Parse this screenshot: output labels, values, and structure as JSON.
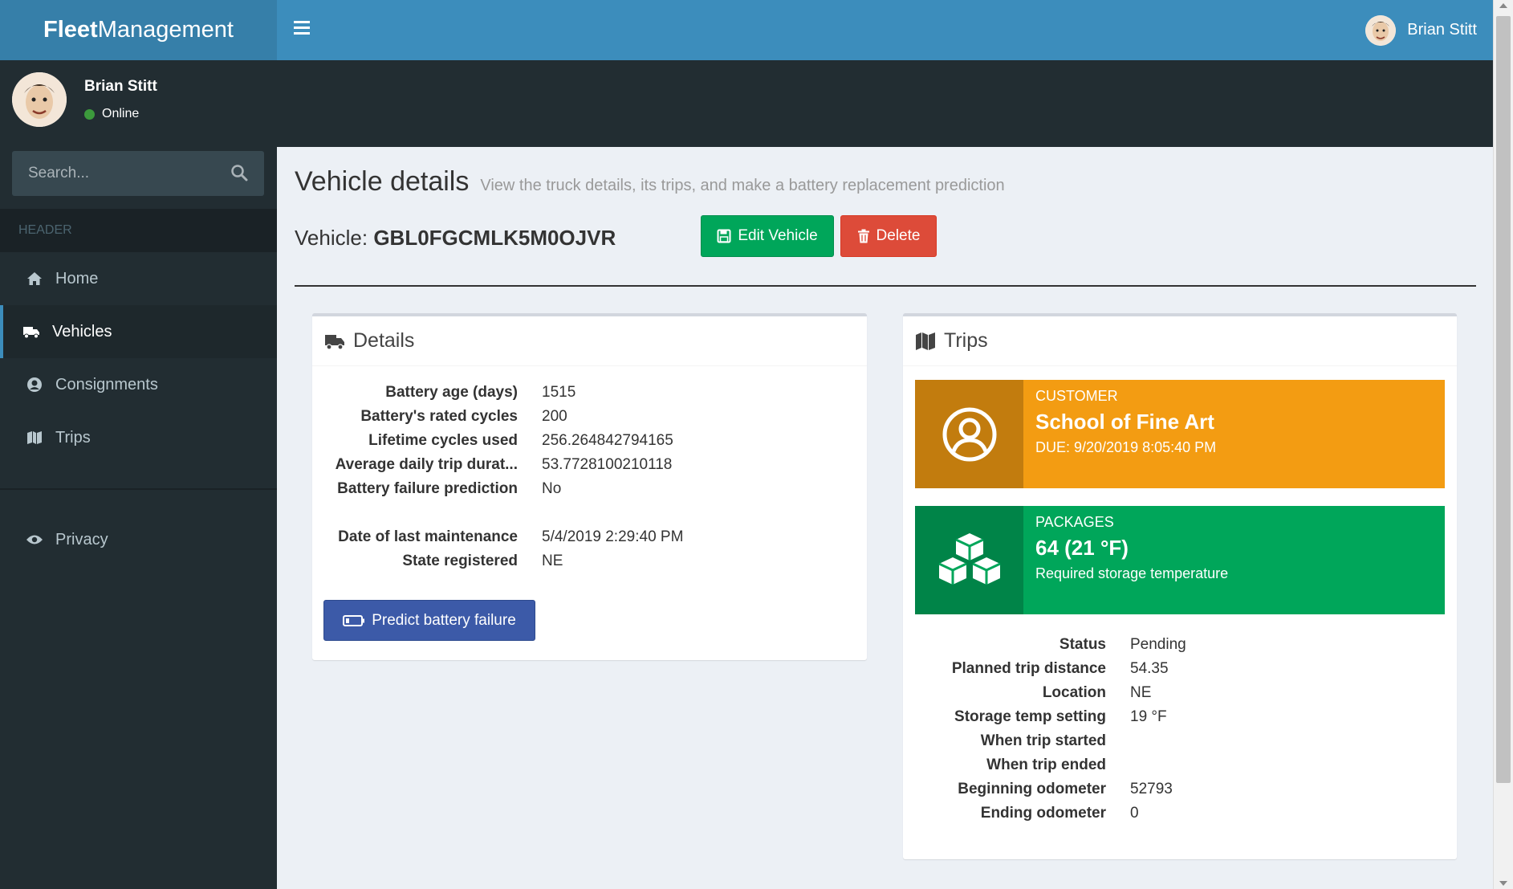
{
  "app": {
    "brand_bold": "Fleet",
    "brand_rest": "Management"
  },
  "top_user": {
    "name": "Brian Stitt"
  },
  "sidebar": {
    "user": {
      "name": "Brian Stitt",
      "status": "Online"
    },
    "search": {
      "placeholder": "Search..."
    },
    "header": "HEADER",
    "items": [
      {
        "label": "Home",
        "icon": "home-icon"
      },
      {
        "label": "Vehicles",
        "icon": "truck-icon",
        "active": true
      },
      {
        "label": "Consignments",
        "icon": "user-circle-icon"
      },
      {
        "label": "Trips",
        "icon": "map-icon"
      }
    ],
    "items2": [
      {
        "label": "Privacy",
        "icon": "eye-icon"
      }
    ]
  },
  "page": {
    "title": "Vehicle details",
    "subtitle": "View the truck details, its trips, and make a battery replacement prediction",
    "vehicle_label": "Vehicle:",
    "vehicle_id": "GBL0FGCMLK5M0OJVR",
    "edit_label": "Edit Vehicle",
    "delete_label": "Delete"
  },
  "details": {
    "title": "Details",
    "rows": [
      {
        "label": "Battery age (days)",
        "value": "1515"
      },
      {
        "label": "Battery's rated cycles",
        "value": "200"
      },
      {
        "label": "Lifetime cycles used",
        "value": "256.264842794165"
      },
      {
        "label": "Average daily trip durat...",
        "value": "53.7728100210118"
      },
      {
        "label": "Battery failure prediction",
        "value": "No"
      }
    ],
    "rows2": [
      {
        "label": "Date of last maintenance",
        "value": "5/4/2019 2:29:40 PM"
      },
      {
        "label": "State registered",
        "value": "NE"
      }
    ],
    "predict_label": "Predict battery failure"
  },
  "trips": {
    "title": "Trips",
    "customer": {
      "label": "CUSTOMER",
      "value": "School of Fine Art",
      "sub": "DUE: 9/20/2019 8:05:40 PM"
    },
    "packages": {
      "label": "PACKAGES",
      "value": "64 (21 °F)",
      "sub": "Required storage temperature"
    },
    "rows": [
      {
        "label": "Status",
        "value": "Pending"
      },
      {
        "label": "Planned trip distance",
        "value": "54.35"
      },
      {
        "label": "Location",
        "value": "NE"
      },
      {
        "label": "Storage temp setting",
        "value": "19 °F"
      },
      {
        "label": "When trip started",
        "value": ""
      },
      {
        "label": "When trip ended",
        "value": ""
      },
      {
        "label": "Beginning odometer",
        "value": "52793"
      },
      {
        "label": "Ending odometer",
        "value": "0"
      }
    ]
  },
  "colors": {
    "topbar": "#3c8dbc",
    "sidebar": "#222d32",
    "success": "#00a65a",
    "danger": "#dd4b39",
    "warning": "#f39c12",
    "primary": "#3c5aa8"
  }
}
